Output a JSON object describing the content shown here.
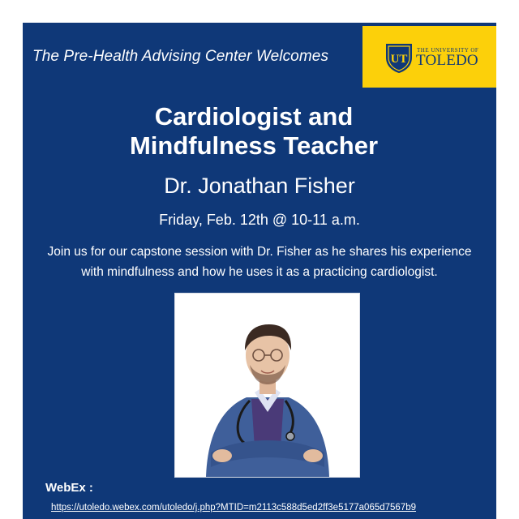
{
  "header": {
    "welcome_text": "The Pre-Health Advising Center Welcomes",
    "logo_small_text": "THE UNIVERSITY OF",
    "logo_big_text": "TOLEDO",
    "logo_monogram": "UT"
  },
  "event": {
    "title_line1": "Cardiologist and",
    "title_line2": "Mindfulness Teacher",
    "speaker": "Dr. Jonathan Fisher",
    "datetime": "Friday, Feb. 12th @ 10-11 a.m.",
    "description_line1": "Join us for our capstone session with Dr. Fisher  as he shares  his  experience",
    "description_line2": "with mindfulness and  how he uses it as a practicing cardiologist."
  },
  "webex": {
    "label": "WebEx :",
    "url": "https://utoledo.webex.com/utoledo/j.php?MTID=m2113c588d5ed2ff3e5177a065d7567b9"
  },
  "colors": {
    "background_blue": "#0f3878",
    "logo_gold": "#fcd00a",
    "text": "#ffffff"
  }
}
